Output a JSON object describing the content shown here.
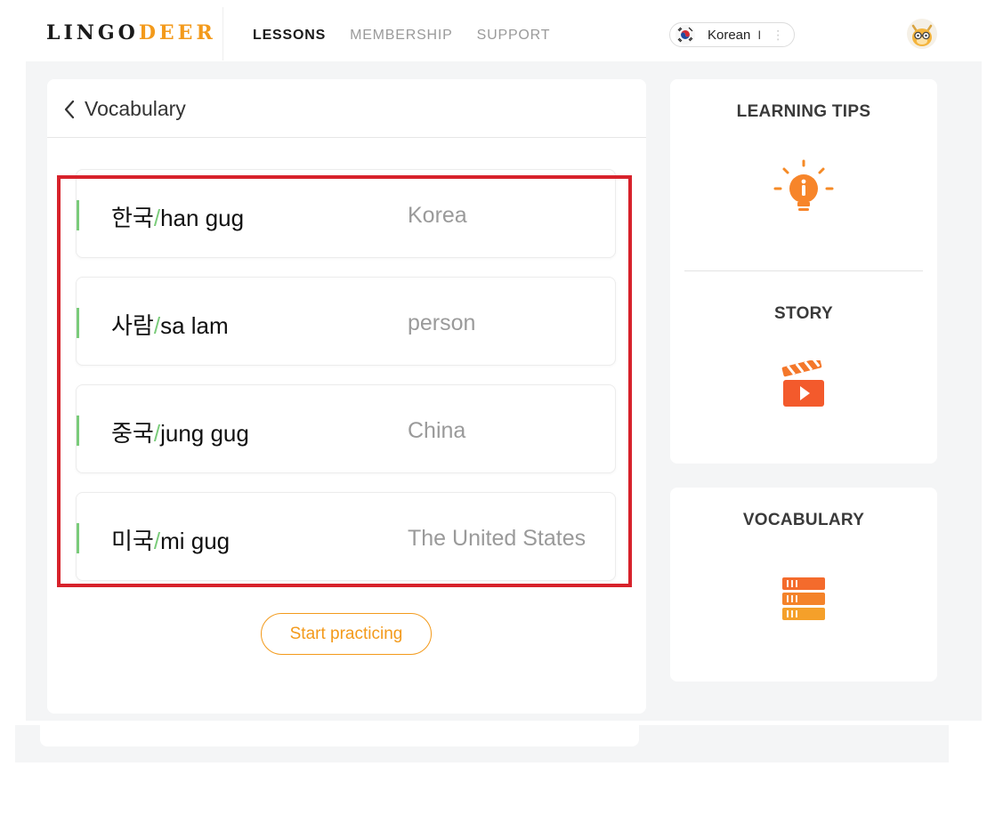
{
  "brand": {
    "logo_main": "LINGO",
    "logo_accent": "DEER"
  },
  "nav": {
    "items": [
      {
        "label": "LESSONS",
        "active": true
      },
      {
        "label": "MEMBERSHIP",
        "active": false
      },
      {
        "label": "SUPPORT",
        "active": false
      }
    ]
  },
  "language": {
    "label": "Korean",
    "level": "I",
    "flag_icon": "korea-flag-icon"
  },
  "main": {
    "back_label": "Vocabulary",
    "items": [
      {
        "native": "한국",
        "romanization": "han gug",
        "meaning": "Korea"
      },
      {
        "native": "사람",
        "romanization": "sa lam",
        "meaning": "person"
      },
      {
        "native": "중국",
        "romanization": "jung gug",
        "meaning": "China"
      },
      {
        "native": "미국",
        "romanization": "mi gug",
        "meaning": "The United States"
      }
    ],
    "start_label": "Start practicing"
  },
  "side": {
    "learning_tips_title": "LEARNING TIPS",
    "story_title": "STORY",
    "vocabulary_title": "VOCABULARY"
  },
  "colors": {
    "accent": "#f39a1b",
    "green_marker": "#7acb7a",
    "highlight_red": "#d7222b"
  }
}
